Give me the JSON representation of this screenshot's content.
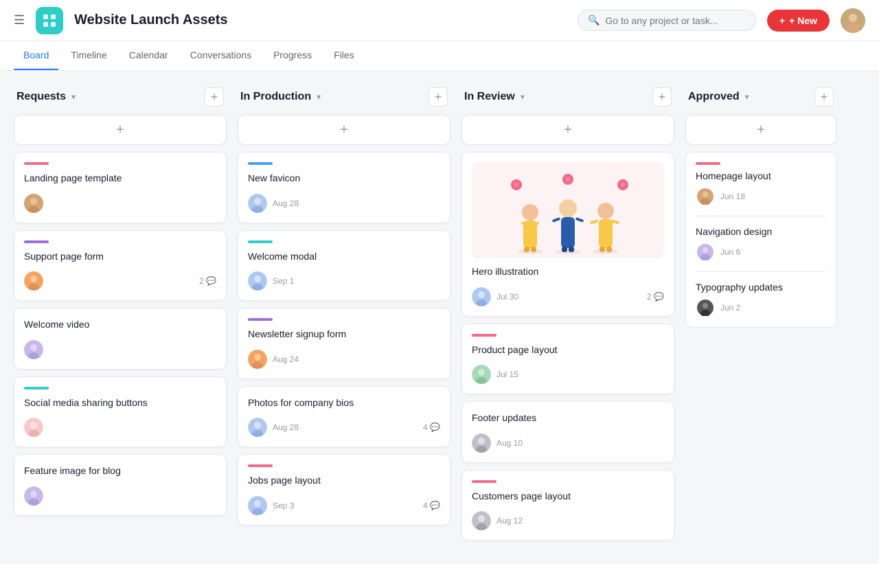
{
  "app": {
    "title": "Website Launch Assets",
    "logo_icon": "▣",
    "search_placeholder": "Go to any project or task..."
  },
  "header": {
    "new_button": "+ New",
    "avatar_initials": "👤"
  },
  "nav": {
    "tabs": [
      {
        "label": "Board",
        "active": true
      },
      {
        "label": "Timeline",
        "active": false
      },
      {
        "label": "Calendar",
        "active": false
      },
      {
        "label": "Conversations",
        "active": false
      },
      {
        "label": "Progress",
        "active": false
      },
      {
        "label": "Files",
        "active": false
      }
    ]
  },
  "columns": [
    {
      "id": "requests",
      "title": "Requests",
      "cards": [
        {
          "id": "c1",
          "tag_color": "#f16b8a",
          "title": "Landing page template",
          "avatar_color": "#d4a574",
          "date": null,
          "comments": null
        },
        {
          "id": "c2",
          "tag_color": "#9c6fd6",
          "title": "Support page form",
          "avatar_color": "#f4a460",
          "date": null,
          "comments": "2"
        },
        {
          "id": "c3",
          "tag_color": null,
          "title": "Welcome video",
          "avatar_color": "#c8b7e8",
          "date": null,
          "comments": null
        },
        {
          "id": "c4",
          "tag_color": "#2ecec6",
          "title": "Social media sharing buttons",
          "avatar_color": "#f7cac9",
          "date": null,
          "comments": null
        },
        {
          "id": "c5",
          "tag_color": null,
          "title": "Feature image for blog",
          "avatar_color": "#c8b7e8",
          "date": null,
          "comments": null
        }
      ]
    },
    {
      "id": "in-production",
      "title": "In Production",
      "cards": [
        {
          "id": "p1",
          "tag_color": "#4a9eff",
          "title": "New favicon",
          "avatar_color": "#b0c8f0",
          "date": "Aug 28",
          "comments": null
        },
        {
          "id": "p2",
          "tag_color": "#2ecec6",
          "title": "Welcome modal",
          "avatar_color": "#b0c8f0",
          "date": "Sep 1",
          "comments": null
        },
        {
          "id": "p3",
          "tag_color": "#9c6fd6",
          "title": "Newsletter signup form",
          "avatar_color": "#f4a460",
          "date": "Aug 24",
          "comments": null
        },
        {
          "id": "p4",
          "tag_color": null,
          "title": "Photos for company bios",
          "avatar_color": "#b0c8f0",
          "date": "Aug 28",
          "comments": "4"
        },
        {
          "id": "p5",
          "tag_color": "#f16b8a",
          "title": "Jobs page layout",
          "avatar_color": "#b0c8f0",
          "date": "Sep 3",
          "comments": "4"
        }
      ]
    },
    {
      "id": "in-review",
      "title": "In Review",
      "cards": [
        {
          "id": "r1",
          "tag_color": null,
          "title": "Hero illustration",
          "avatar_color": "#b0c8f0",
          "date": "Jul 30",
          "comments": "2",
          "has_image": true
        },
        {
          "id": "r2",
          "tag_color": "#f16b8a",
          "title": "Product page layout",
          "avatar_color": "#a8d8b9",
          "date": "Jul 15",
          "comments": null
        },
        {
          "id": "r3",
          "tag_color": null,
          "title": "Footer updates",
          "avatar_color": "#c0c0c8",
          "date": "Aug 10",
          "comments": null
        },
        {
          "id": "r4",
          "tag_color": "#f16b8a",
          "title": "Customers page layout",
          "avatar_color": "#c0c0c8",
          "date": "Aug 12",
          "comments": null
        }
      ]
    },
    {
      "id": "approved",
      "title": "Approved",
      "cards": [
        {
          "id": "a1",
          "tag_color": "#f16b8a",
          "title": "Homepage layout",
          "avatar_color": "#d4a574",
          "date": "Jun 18"
        },
        {
          "id": "a2",
          "tag_color": null,
          "title": "Navigation design",
          "avatar_color": "#c8b7e8",
          "date": "Jun 6"
        },
        {
          "id": "a3",
          "tag_color": null,
          "title": "Typography updates",
          "avatar_color": "#555",
          "date": "Jun 2"
        }
      ]
    }
  ]
}
